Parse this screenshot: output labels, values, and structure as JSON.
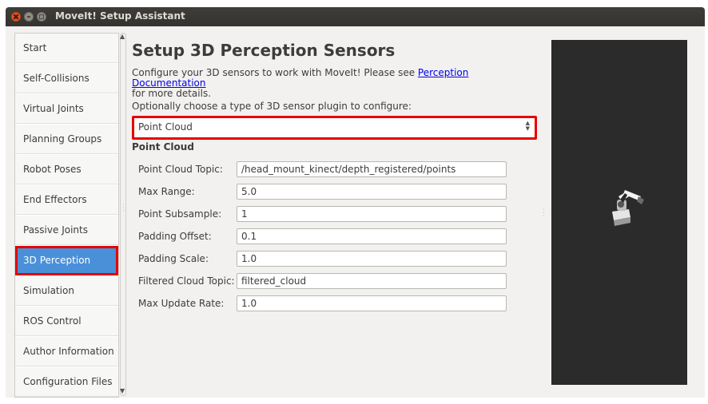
{
  "window": {
    "title": "MoveIt! Setup Assistant"
  },
  "sidebar": {
    "items": [
      {
        "label": "Start",
        "active": false
      },
      {
        "label": "Self-Collisions",
        "active": false
      },
      {
        "label": "Virtual Joints",
        "active": false
      },
      {
        "label": "Planning Groups",
        "active": false
      },
      {
        "label": "Robot Poses",
        "active": false
      },
      {
        "label": "End Effectors",
        "active": false
      },
      {
        "label": "Passive Joints",
        "active": false
      },
      {
        "label": "3D Perception",
        "active": true
      },
      {
        "label": "Simulation",
        "active": false
      },
      {
        "label": "ROS Control",
        "active": false
      },
      {
        "label": "Author Information",
        "active": false
      },
      {
        "label": "Configuration Files",
        "active": false
      }
    ]
  },
  "main": {
    "title": "Setup 3D Perception Sensors",
    "desc_pre": "Configure your 3D sensors to work with MoveIt! Please see ",
    "desc_link": "Perception Documentation",
    "desc_post": "for more details.",
    "choose_label": "Optionally choose a type of 3D sensor plugin to configure:",
    "plugin_select_value": "Point Cloud",
    "group_title": "Point Cloud",
    "fields": [
      {
        "label": "Point Cloud Topic:",
        "value": "/head_mount_kinect/depth_registered/points"
      },
      {
        "label": "Max Range:",
        "value": "5.0"
      },
      {
        "label": "Point Subsample:",
        "value": "1"
      },
      {
        "label": "Padding Offset:",
        "value": "0.1"
      },
      {
        "label": "Padding Scale:",
        "value": "1.0"
      },
      {
        "label": "Filtered Cloud Topic:",
        "value": "filtered_cloud"
      },
      {
        "label": "Max Update Rate:",
        "value": "1.0"
      }
    ]
  },
  "colors": {
    "accent": "#4a90d9",
    "highlight_box": "#e60000",
    "titlebar": "#3c3b37",
    "viewport_bg": "#2b2b2b"
  }
}
